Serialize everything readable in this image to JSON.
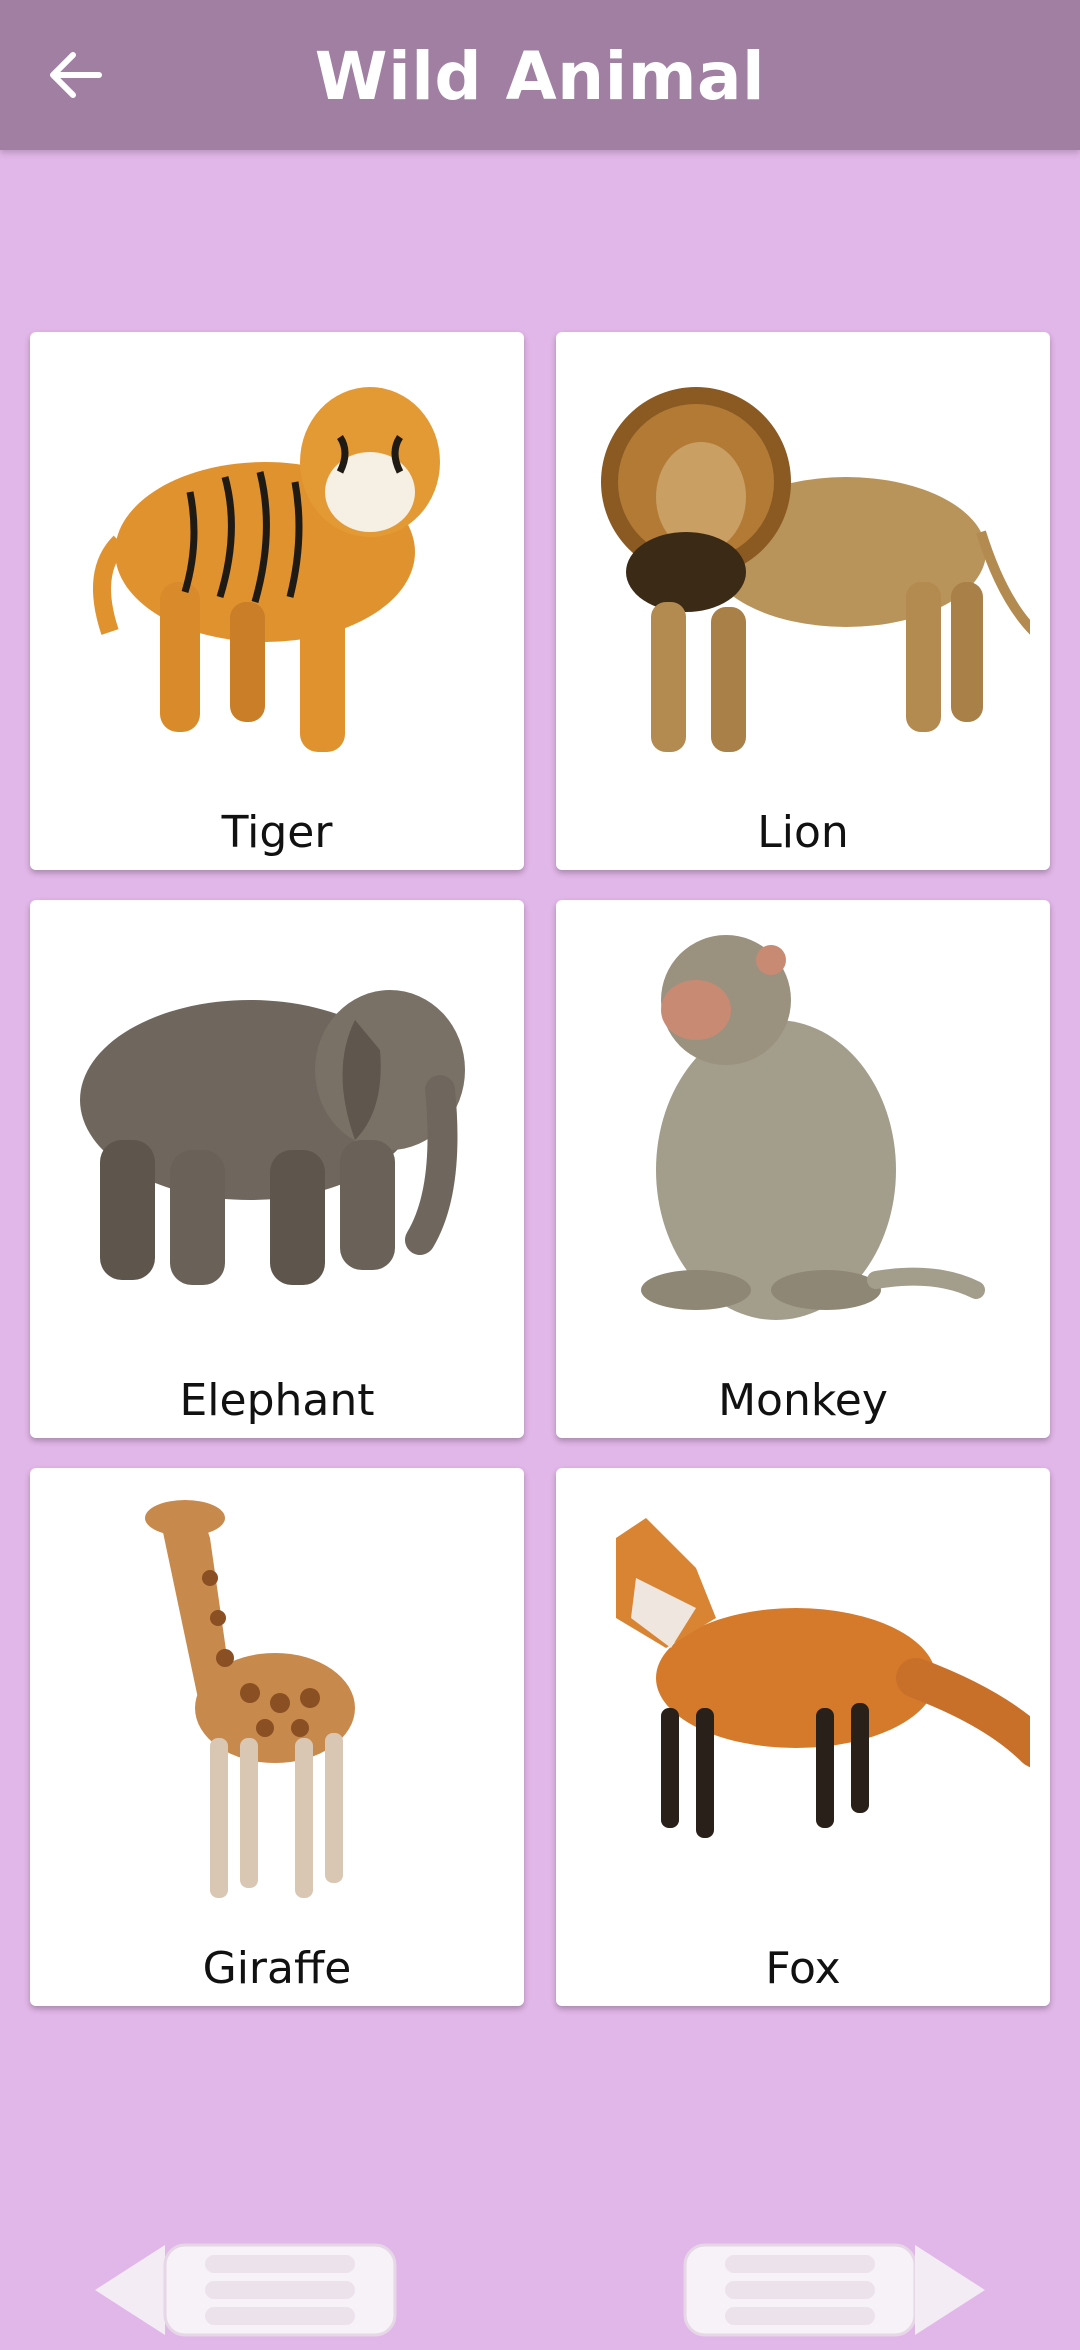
{
  "appbar": {
    "title": "Wild Animal",
    "back_icon": "arrow-left-icon"
  },
  "animals": [
    {
      "label": "Tiger"
    },
    {
      "label": "Lion"
    },
    {
      "label": "Elephant"
    },
    {
      "label": "Monkey"
    },
    {
      "label": "Giraffe"
    },
    {
      "label": "Fox"
    }
  ],
  "colors": {
    "appbar": "#a07fa3",
    "background": "#e1b6e8",
    "card": "#ffffff"
  },
  "nav": {
    "prev_icon": "pencil-arrow-left-icon",
    "next_icon": "pencil-arrow-right-icon"
  }
}
